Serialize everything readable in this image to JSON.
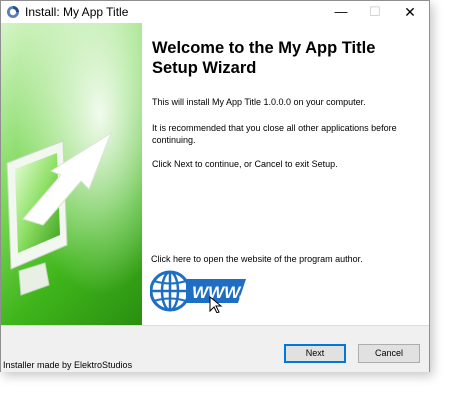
{
  "window": {
    "title": "Install: My App Title",
    "minimize_glyph": "—",
    "maximize_glyph": "☐",
    "close_glyph": "✕"
  },
  "content": {
    "heading": "Welcome to the My App Title Setup Wizard",
    "paragraph_1": "This will install My App Title 1.0.0.0 on your computer.",
    "paragraph_2": "It is recommended that you close all other applications before continuing.",
    "paragraph_3": "Click Next to continue, or Cancel to exit Setup.",
    "author_link": "Click here to open the website of the program author."
  },
  "www_icon": {
    "text": "WWW.",
    "icon": "globe-www-icon"
  },
  "footer": {
    "credit": "Installer made by ElektroStudios"
  },
  "buttons": {
    "next": "Next",
    "cancel": "Cancel"
  },
  "colors": {
    "accent": "#0078d7",
    "banner_green": "#3fb51b",
    "www_blue": "#1e6fc4"
  },
  "icons": {
    "app": "installer-app-icon",
    "banner": "monitor-arrow-icon"
  }
}
